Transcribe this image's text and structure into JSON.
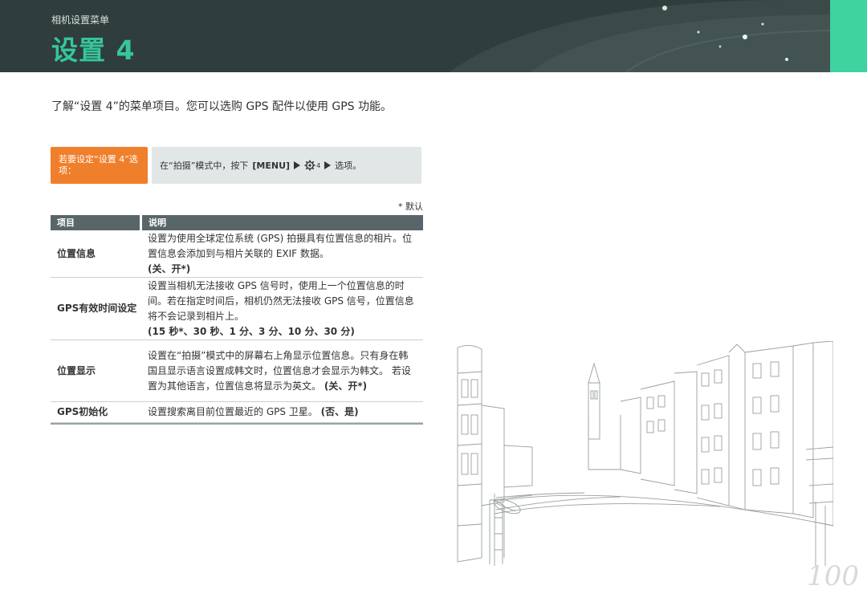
{
  "header": {
    "subtitle": "相机设置菜单",
    "title": "设置 4"
  },
  "intro": "了解“设置 4”的菜单项目。您可以选购 GPS 配件以使用 GPS 功能。",
  "howto": {
    "label": "若要设定“设置 4”选项：",
    "prefix": "在“拍摄”模式中，按下",
    "menu_key": "[MENU]",
    "gear_num": "4",
    "suffix": "选项。"
  },
  "default_note": "* 默认",
  "table": {
    "headers": {
      "item": "项目",
      "desc": "说明"
    },
    "rows": [
      {
        "item": "位置信息",
        "desc": "设置为使用全球定位系统 (GPS) 拍摄具有位置信息的相片。位置信息会添加到与相片关联的 EXIF 数据。",
        "options": "(关、开*)"
      },
      {
        "item": "GPS有效时间设定",
        "desc": "设置当相机无法接收 GPS 信号时，使用上一个位置信息的时间。若在指定时间后，相机仍然无法接收 GPS 信号，位置信息将不会记录到相片上。",
        "options": "(15 秒*、30 秒、1 分、3 分、10 分、30 分)"
      },
      {
        "item": "位置显示",
        "desc": "设置在“拍摄”模式中的屏幕右上角显示位置信息。只有身在韩国且显示语言设置成韩文时，位置信息才会显示为韩文。 若设置为其他语言，位置信息将显示为英文。",
        "options": "(关、开*)"
      },
      {
        "item": "GPS初始化",
        "desc": "设置搜索离目前位置最近的 GPS 卫星。",
        "options": "(否、是)"
      }
    ]
  },
  "page_number": "100",
  "colors": {
    "header_bg": "#2f3d3c",
    "title_green": "#36c69a",
    "tab_green": "#3fd3a0",
    "howto_orange": "#f07f2c",
    "howto_body_bg": "#e1e6e6",
    "table_header_bg": "#58666a"
  },
  "icons": [
    "gear-icon",
    "triangle-right-icon"
  ]
}
